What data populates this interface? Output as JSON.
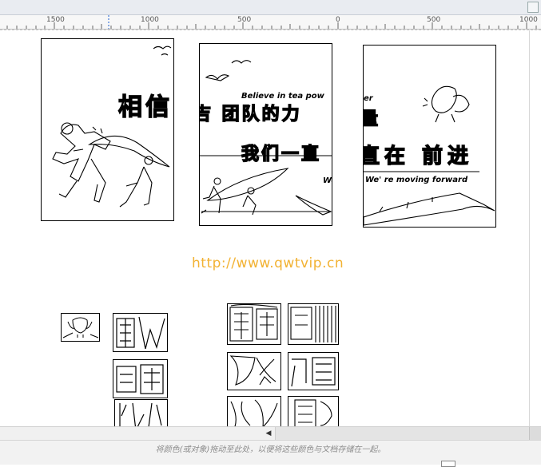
{
  "ruler": {
    "labels": [
      "1500",
      "1000",
      "500",
      "0",
      "500",
      "1000"
    ]
  },
  "sheets": {
    "sheet1": {
      "glyphs": "相信"
    },
    "sheet2": {
      "subtitle": "Believe in tea pow",
      "line1": "吉 团队的力",
      "line2": "我们一直",
      "line3": "We"
    },
    "sheet3": {
      "subtitle": "er",
      "line1": "量",
      "line2": "直在 前进",
      "line3": "We' re moving forward"
    }
  },
  "watermark": "http://www.qwtvip.cn",
  "status": {
    "hint": "将颜色(或对象)拖动至此处，以便将这些颜色与文档存储在一起。"
  },
  "icons": {
    "scroll_left": "scroll-left-arrow-icon",
    "window_button": "window-button-icon"
  }
}
